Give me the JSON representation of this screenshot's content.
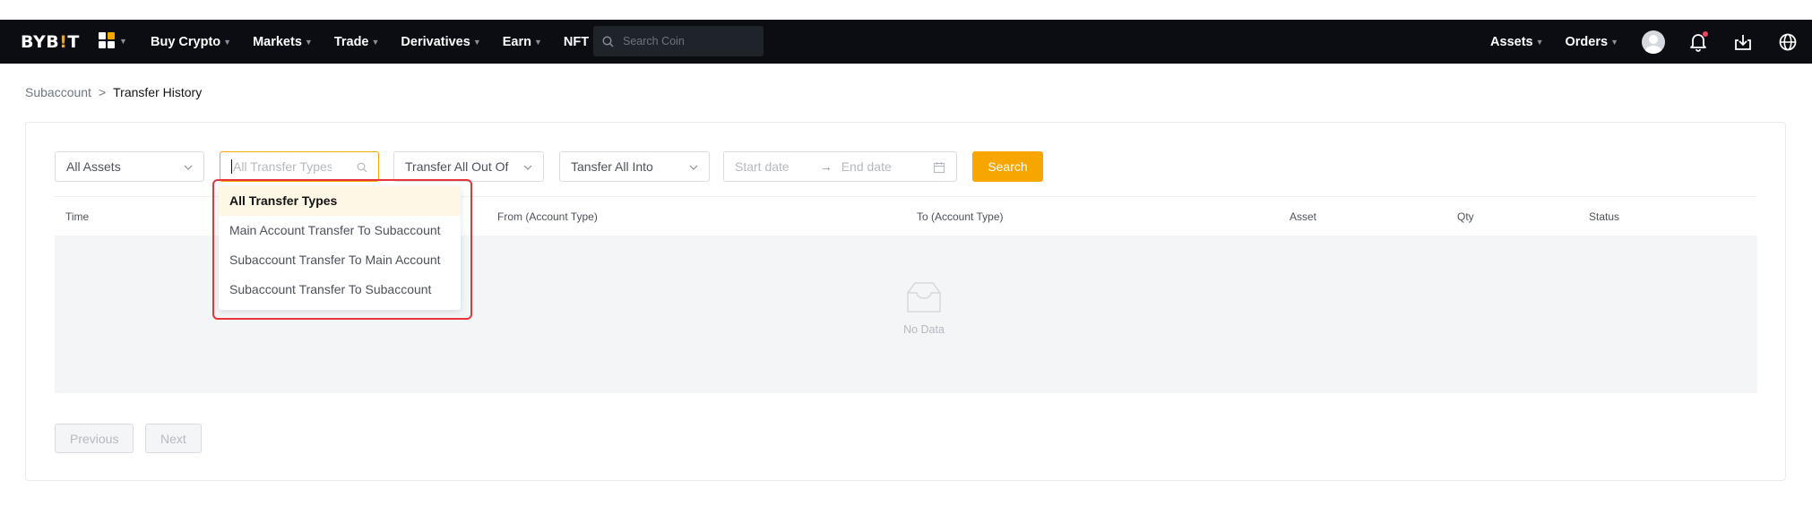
{
  "brand": {
    "logo_pre": "BYB",
    "logo_bang": "!",
    "logo_post": "T",
    "accent": "#f7a600"
  },
  "nav": {
    "items": [
      {
        "label": "Buy Crypto",
        "caret": "▼"
      },
      {
        "label": "Markets",
        "caret": "▼"
      },
      {
        "label": "Trade",
        "caret": "▼"
      },
      {
        "label": "Derivatives",
        "caret": "▼"
      },
      {
        "label": "Earn",
        "caret": "▼"
      },
      {
        "label": "NFT",
        "caret": ""
      }
    ],
    "search_placeholder": "Search Coin",
    "right": [
      {
        "label": "Assets",
        "caret": "▼"
      },
      {
        "label": "Orders",
        "caret": "▼"
      }
    ]
  },
  "breadcrumb": {
    "parent": "Subaccount",
    "separator": ">",
    "current": "Transfer History"
  },
  "filters": {
    "assets": "All Assets",
    "transfer_types_placeholder": "All Transfer Types",
    "out_of": "Transfer All Out Of",
    "into": "Tansfer All Into",
    "start_date": "Start date",
    "arrow": "→",
    "end_date": "End date",
    "search_button": "Search"
  },
  "table": {
    "columns": [
      "Time",
      "From (Account Type)",
      "To (Account Type)",
      "Asset",
      "Qty",
      "Status"
    ],
    "empty_text": "No Data"
  },
  "pagination": {
    "previous": "Previous",
    "next": "Next"
  },
  "dropdown": {
    "options": [
      "All Transfer Types",
      "Main Account Transfer To Subaccount",
      "Subaccount Transfer To Main Account",
      "Subaccount Transfer To Subaccount"
    ],
    "selected_index": 0,
    "highlight_color": "#e8343a"
  }
}
